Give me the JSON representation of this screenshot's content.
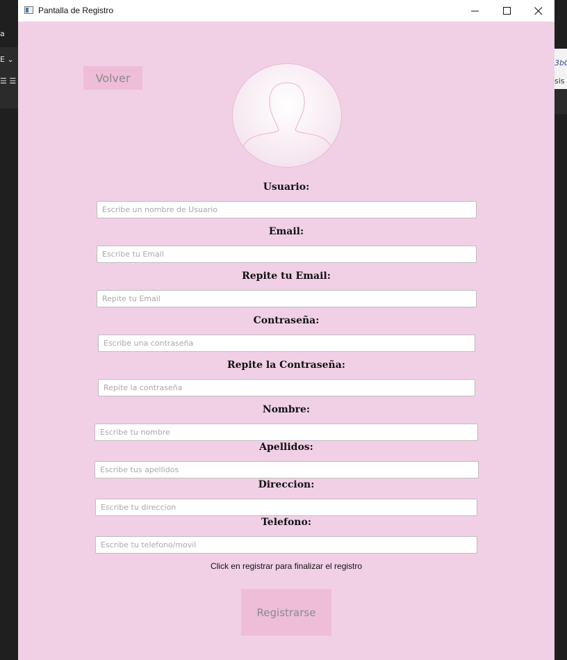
{
  "window": {
    "title": "Pantalla de Registro",
    "controls": [
      "minimize-icon",
      "maximize-icon",
      "close-icon"
    ]
  },
  "background": {
    "left_texts": [
      "a",
      "E ⌄",
      "☰ ☰"
    ],
    "right_texts": [
      "3bC",
      "sis"
    ]
  },
  "back_button": {
    "label": "Volver"
  },
  "avatar": {
    "icon": "user-silhouette-icon"
  },
  "form": {
    "fields": [
      {
        "label": "Usuario:",
        "placeholder": "Escribe un nombre de Usuario",
        "value": ""
      },
      {
        "label": "Email:",
        "placeholder": "Escribe tu Email",
        "value": ""
      },
      {
        "label": "Repite tu Email:",
        "placeholder": "Repite tu Email",
        "value": ""
      },
      {
        "label": "Contraseña:",
        "placeholder": "Escribe una contraseña",
        "value": ""
      },
      {
        "label": "Repite la Contraseña:",
        "placeholder": "Repite la contraseña",
        "value": ""
      },
      {
        "label": "Nombre:",
        "placeholder": "Escribe tu nombre",
        "value": ""
      },
      {
        "label": "Apellidos:",
        "placeholder": "Escribe tus apellidos",
        "value": ""
      },
      {
        "label": "Direccion:",
        "placeholder": "Escribe tu direccion",
        "value": ""
      },
      {
        "label": "Telefono:",
        "placeholder": "Escribe tu telefono/movil",
        "value": ""
      }
    ]
  },
  "hint": "Click en registrar para finalizar el registro",
  "register_button": {
    "label": "Registrarse"
  },
  "colors": {
    "window_bg": "#f1d0e6",
    "button_bg": "#eebdd8",
    "button_text": "#8c8a8b"
  }
}
